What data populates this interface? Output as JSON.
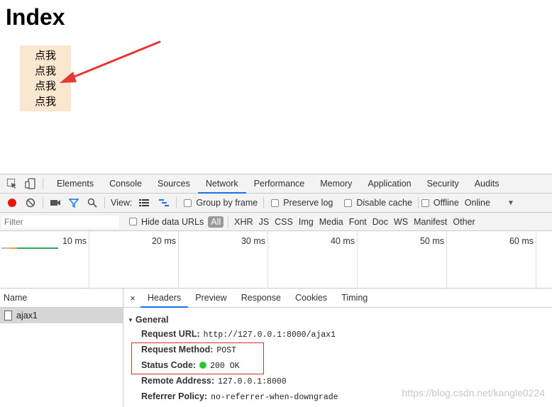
{
  "page": {
    "title": "Index",
    "click_items": [
      "点我",
      "点我",
      "点我",
      "点我"
    ]
  },
  "devtools": {
    "tabs": [
      {
        "label": "Elements"
      },
      {
        "label": "Console"
      },
      {
        "label": "Sources"
      },
      {
        "label": "Network",
        "active": true
      },
      {
        "label": "Performance"
      },
      {
        "label": "Memory"
      },
      {
        "label": "Application"
      },
      {
        "label": "Security"
      },
      {
        "label": "Audits"
      }
    ],
    "toolbar": {
      "view_label": "View:",
      "group_by_frame": "Group by frame",
      "preserve_log": "Preserve log",
      "disable_cache": "Disable cache",
      "offline": "Offline",
      "throttle": "Online"
    },
    "filter": {
      "placeholder": "Filter",
      "hide_data_urls": "Hide data URLs",
      "types": [
        "All",
        "XHR",
        "JS",
        "CSS",
        "Img",
        "Media",
        "Font",
        "Doc",
        "WS",
        "Manifest",
        "Other"
      ]
    },
    "timeline": {
      "ticks": [
        "10 ms",
        "20 ms",
        "30 ms",
        "40 ms",
        "50 ms",
        "60 ms"
      ]
    },
    "requests": {
      "name_header": "Name",
      "items": [
        "ajax1"
      ]
    },
    "detail": {
      "close": "×",
      "tabs": [
        "Headers",
        "Preview",
        "Response",
        "Cookies",
        "Timing"
      ],
      "active_tab": "Headers",
      "general_label": "General",
      "rows": [
        {
          "key": "Request URL:",
          "value": "http://127.0.0.1:8000/ajax1"
        },
        {
          "key": "Request Method:",
          "value": "POST"
        },
        {
          "key": "Status Code:",
          "value": "200 OK"
        },
        {
          "key": "Remote Address:",
          "value": "127.0.0.1:8000"
        },
        {
          "key": "Referrer Policy:",
          "value": "no-referrer-when-downgrade"
        }
      ]
    }
  },
  "watermark": "https://blog.csdn.net/kangle0224",
  "colors": {
    "accent": "#1a73e8",
    "record": "#e8170c",
    "status_ok": "#32c241",
    "annotation": "#e53935",
    "click_box_bg": "#fbe7d0"
  }
}
